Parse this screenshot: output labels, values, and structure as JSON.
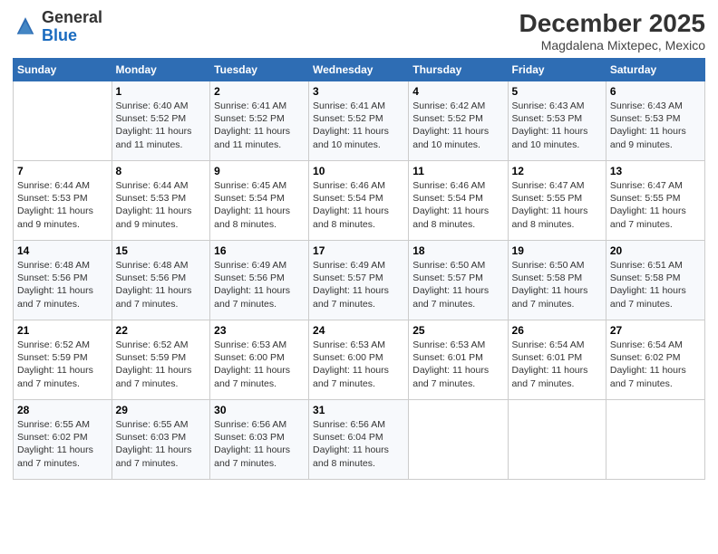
{
  "header": {
    "logo_general": "General",
    "logo_blue": "Blue",
    "month_title": "December 2025",
    "location": "Magdalena Mixtepec, Mexico"
  },
  "days_of_week": [
    "Sunday",
    "Monday",
    "Tuesday",
    "Wednesday",
    "Thursday",
    "Friday",
    "Saturday"
  ],
  "weeks": [
    [
      {
        "day": "",
        "info": ""
      },
      {
        "day": "1",
        "info": "Sunrise: 6:40 AM\nSunset: 5:52 PM\nDaylight: 11 hours and 11 minutes."
      },
      {
        "day": "2",
        "info": "Sunrise: 6:41 AM\nSunset: 5:52 PM\nDaylight: 11 hours and 11 minutes."
      },
      {
        "day": "3",
        "info": "Sunrise: 6:41 AM\nSunset: 5:52 PM\nDaylight: 11 hours and 10 minutes."
      },
      {
        "day": "4",
        "info": "Sunrise: 6:42 AM\nSunset: 5:52 PM\nDaylight: 11 hours and 10 minutes."
      },
      {
        "day": "5",
        "info": "Sunrise: 6:43 AM\nSunset: 5:53 PM\nDaylight: 11 hours and 10 minutes."
      },
      {
        "day": "6",
        "info": "Sunrise: 6:43 AM\nSunset: 5:53 PM\nDaylight: 11 hours and 9 minutes."
      }
    ],
    [
      {
        "day": "7",
        "info": "Sunrise: 6:44 AM\nSunset: 5:53 PM\nDaylight: 11 hours and 9 minutes."
      },
      {
        "day": "8",
        "info": "Sunrise: 6:44 AM\nSunset: 5:53 PM\nDaylight: 11 hours and 9 minutes."
      },
      {
        "day": "9",
        "info": "Sunrise: 6:45 AM\nSunset: 5:54 PM\nDaylight: 11 hours and 8 minutes."
      },
      {
        "day": "10",
        "info": "Sunrise: 6:46 AM\nSunset: 5:54 PM\nDaylight: 11 hours and 8 minutes."
      },
      {
        "day": "11",
        "info": "Sunrise: 6:46 AM\nSunset: 5:54 PM\nDaylight: 11 hours and 8 minutes."
      },
      {
        "day": "12",
        "info": "Sunrise: 6:47 AM\nSunset: 5:55 PM\nDaylight: 11 hours and 8 minutes."
      },
      {
        "day": "13",
        "info": "Sunrise: 6:47 AM\nSunset: 5:55 PM\nDaylight: 11 hours and 7 minutes."
      }
    ],
    [
      {
        "day": "14",
        "info": "Sunrise: 6:48 AM\nSunset: 5:56 PM\nDaylight: 11 hours and 7 minutes."
      },
      {
        "day": "15",
        "info": "Sunrise: 6:48 AM\nSunset: 5:56 PM\nDaylight: 11 hours and 7 minutes."
      },
      {
        "day": "16",
        "info": "Sunrise: 6:49 AM\nSunset: 5:56 PM\nDaylight: 11 hours and 7 minutes."
      },
      {
        "day": "17",
        "info": "Sunrise: 6:49 AM\nSunset: 5:57 PM\nDaylight: 11 hours and 7 minutes."
      },
      {
        "day": "18",
        "info": "Sunrise: 6:50 AM\nSunset: 5:57 PM\nDaylight: 11 hours and 7 minutes."
      },
      {
        "day": "19",
        "info": "Sunrise: 6:50 AM\nSunset: 5:58 PM\nDaylight: 11 hours and 7 minutes."
      },
      {
        "day": "20",
        "info": "Sunrise: 6:51 AM\nSunset: 5:58 PM\nDaylight: 11 hours and 7 minutes."
      }
    ],
    [
      {
        "day": "21",
        "info": "Sunrise: 6:52 AM\nSunset: 5:59 PM\nDaylight: 11 hours and 7 minutes."
      },
      {
        "day": "22",
        "info": "Sunrise: 6:52 AM\nSunset: 5:59 PM\nDaylight: 11 hours and 7 minutes."
      },
      {
        "day": "23",
        "info": "Sunrise: 6:53 AM\nSunset: 6:00 PM\nDaylight: 11 hours and 7 minutes."
      },
      {
        "day": "24",
        "info": "Sunrise: 6:53 AM\nSunset: 6:00 PM\nDaylight: 11 hours and 7 minutes."
      },
      {
        "day": "25",
        "info": "Sunrise: 6:53 AM\nSunset: 6:01 PM\nDaylight: 11 hours and 7 minutes."
      },
      {
        "day": "26",
        "info": "Sunrise: 6:54 AM\nSunset: 6:01 PM\nDaylight: 11 hours and 7 minutes."
      },
      {
        "day": "27",
        "info": "Sunrise: 6:54 AM\nSunset: 6:02 PM\nDaylight: 11 hours and 7 minutes."
      }
    ],
    [
      {
        "day": "28",
        "info": "Sunrise: 6:55 AM\nSunset: 6:02 PM\nDaylight: 11 hours and 7 minutes."
      },
      {
        "day": "29",
        "info": "Sunrise: 6:55 AM\nSunset: 6:03 PM\nDaylight: 11 hours and 7 minutes."
      },
      {
        "day": "30",
        "info": "Sunrise: 6:56 AM\nSunset: 6:03 PM\nDaylight: 11 hours and 7 minutes."
      },
      {
        "day": "31",
        "info": "Sunrise: 6:56 AM\nSunset: 6:04 PM\nDaylight: 11 hours and 8 minutes."
      },
      {
        "day": "",
        "info": ""
      },
      {
        "day": "",
        "info": ""
      },
      {
        "day": "",
        "info": ""
      }
    ]
  ]
}
